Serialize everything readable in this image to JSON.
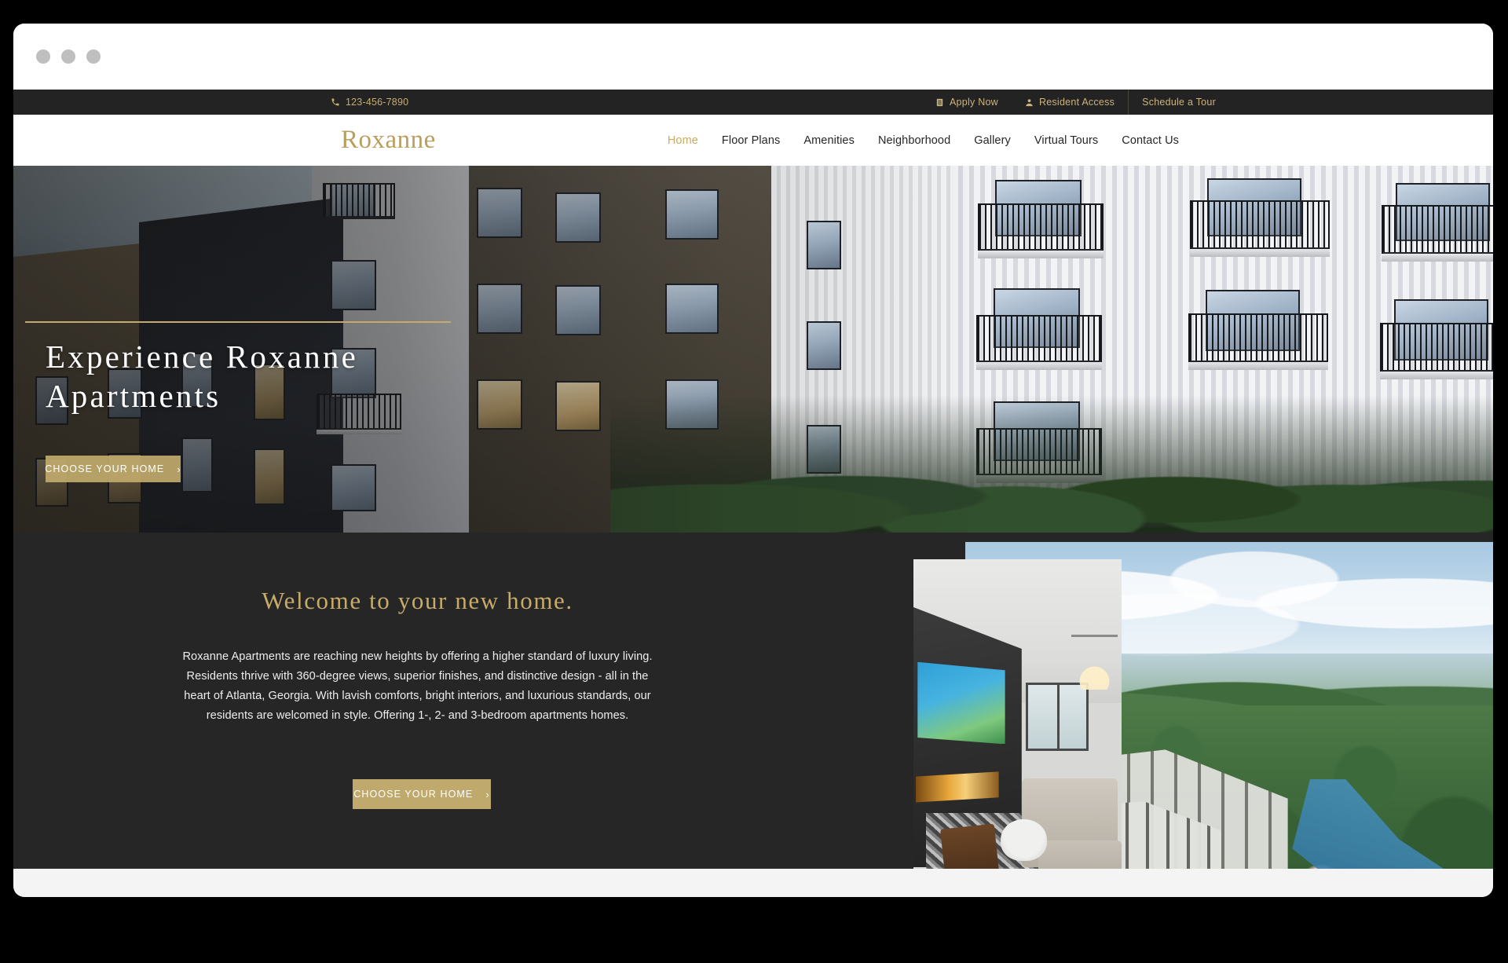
{
  "browser": {
    "dots": [
      "window-dot-1",
      "window-dot-2",
      "window-dot-3"
    ]
  },
  "utility_bar": {
    "phone": "123-456-7890",
    "phone_icon": "phone-icon",
    "links": [
      {
        "label": "Apply Now",
        "icon": "clipboard-icon"
      },
      {
        "label": "Resident Access",
        "icon": "user-icon"
      },
      {
        "label": "Schedule a Tour",
        "icon": ""
      }
    ],
    "background_color": "#232323",
    "text_color": "#cdb47c"
  },
  "header": {
    "logo": "Roxanne",
    "logo_color": "#b99f5f",
    "nav": [
      {
        "label": "Home",
        "active": true
      },
      {
        "label": "Floor Plans",
        "active": false
      },
      {
        "label": "Amenities",
        "active": false
      },
      {
        "label": "Neighborhood",
        "active": false
      },
      {
        "label": "Gallery",
        "active": false
      },
      {
        "label": "Virtual Tours",
        "active": false
      },
      {
        "label": "Contact Us",
        "active": false
      }
    ],
    "active_color": "#c9ab63"
  },
  "hero": {
    "title": "Experience Roxanne Apartments",
    "cta_label": "CHOOSE YOUR HOME",
    "cta_chevron": "›",
    "rule_color": "#c3aa6e",
    "image_alt": "apartment-building-exterior-photo"
  },
  "welcome": {
    "heading": "Welcome to your new home.",
    "heading_color": "#c7ab68",
    "body": "Roxanne Apartments are reaching new heights by offering a higher standard of luxury living. Residents thrive with 360-degree views, superior finishes, and distinctive design - all in the heart of Atlanta, Georgia. With lavish comforts, bright interiors, and luxurious standards, our residents are welcomed in style. Offering 1-, 2- and 3-bedroom apartments homes.",
    "cta_label": "CHOOSE YOUR HOME",
    "cta_chevron": "›",
    "background_color": "#262626",
    "images": [
      {
        "alt": "aerial-community-view-photo"
      },
      {
        "alt": "interior-living-room-photo"
      }
    ]
  },
  "theme": {
    "gold": "#bfa96c",
    "dark": "#262626"
  }
}
